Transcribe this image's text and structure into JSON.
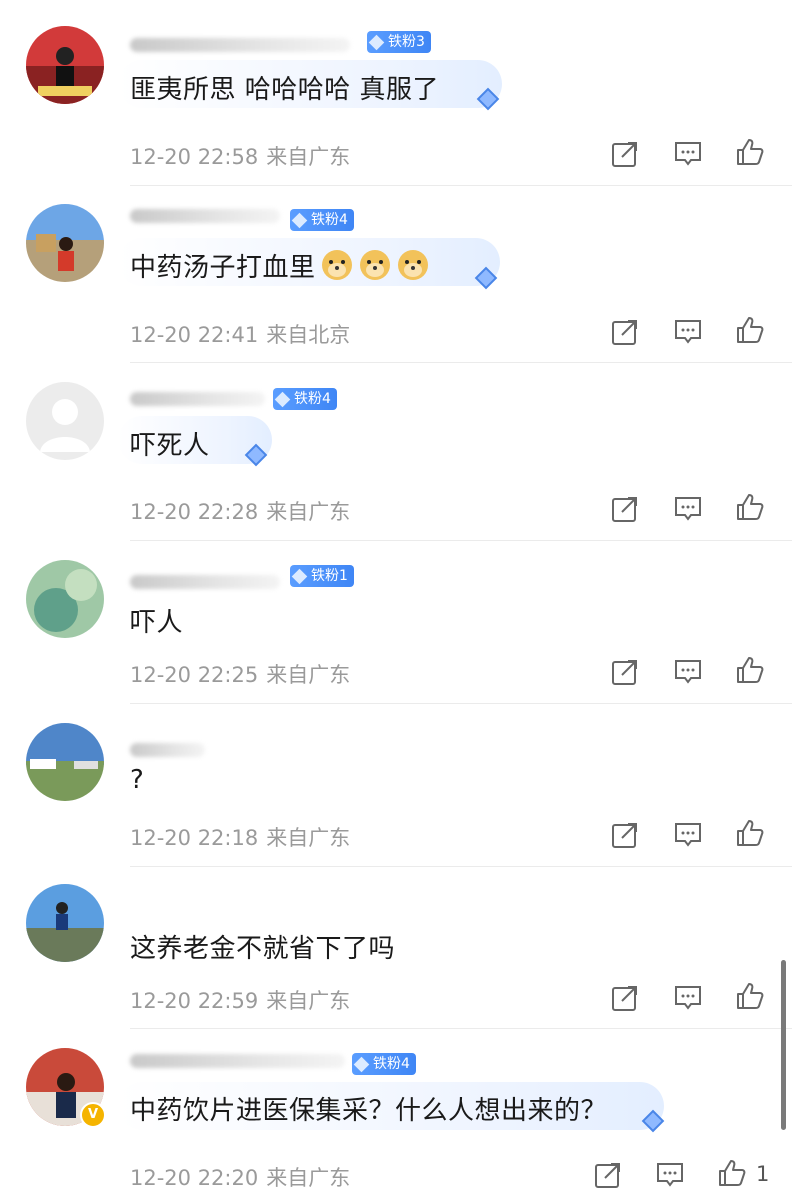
{
  "comments": [
    {
      "fan_badge": "铁粉3",
      "text": "匪夷所思 哈哈哈哈 真服了",
      "date": "12-20 22:58",
      "location": "来自广东",
      "likes": ""
    },
    {
      "fan_badge": "铁粉4",
      "text": "中药汤子打血里",
      "date": "12-20 22:41",
      "location": "来自北京",
      "likes": ""
    },
    {
      "fan_badge": "铁粉4",
      "text": "吓死人",
      "date": "12-20 22:28",
      "location": "来自广东",
      "likes": ""
    },
    {
      "fan_badge": "铁粉1",
      "text": "吓人",
      "date": "12-20 22:25",
      "location": "来自广东",
      "likes": ""
    },
    {
      "fan_badge": "",
      "text": "?",
      "date": "12-20 22:18",
      "location": "来自广东",
      "likes": ""
    },
    {
      "fan_badge": "",
      "text": "这养老金不就省下了吗",
      "date": "12-20 22:59",
      "location": "来自广东",
      "likes": ""
    },
    {
      "fan_badge": "铁粉4",
      "text": "中药饮片进医保集采？什么人想出来的？",
      "date": "12-20 22:20",
      "location": "来自广东",
      "likes": "1"
    }
  ],
  "icons": {
    "share": "share-icon",
    "reply": "comment-icon",
    "like": "thumbs-up-icon",
    "emoji": "doge-emoji-icon",
    "verified": "verified-v-icon"
  },
  "colors": {
    "badge": "#4a90f5",
    "meta": "#9a9a9a",
    "verified": "#f5b400"
  }
}
